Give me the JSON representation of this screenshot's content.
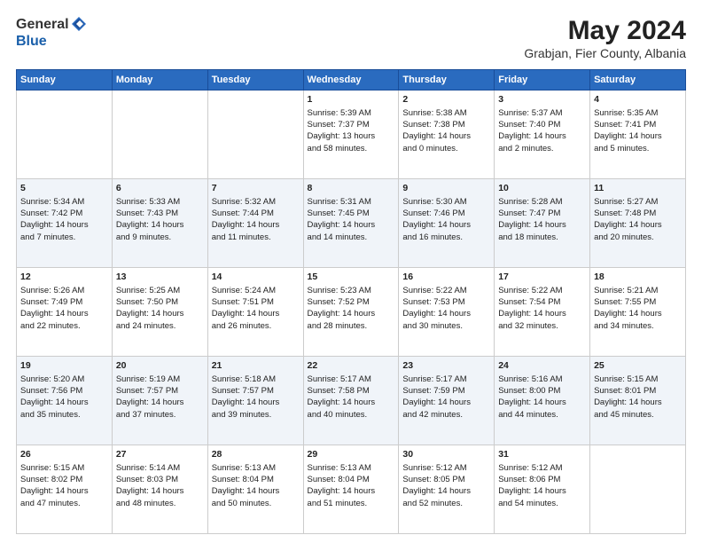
{
  "logo": {
    "general": "General",
    "blue": "Blue"
  },
  "title": "May 2024",
  "subtitle": "Grabjan, Fier County, Albania",
  "days_of_week": [
    "Sunday",
    "Monday",
    "Tuesday",
    "Wednesday",
    "Thursday",
    "Friday",
    "Saturday"
  ],
  "weeks": [
    [
      {
        "day": "",
        "info": ""
      },
      {
        "day": "",
        "info": ""
      },
      {
        "day": "",
        "info": ""
      },
      {
        "day": "1",
        "info": "Sunrise: 5:39 AM\nSunset: 7:37 PM\nDaylight: 13 hours\nand 58 minutes."
      },
      {
        "day": "2",
        "info": "Sunrise: 5:38 AM\nSunset: 7:38 PM\nDaylight: 14 hours\nand 0 minutes."
      },
      {
        "day": "3",
        "info": "Sunrise: 5:37 AM\nSunset: 7:40 PM\nDaylight: 14 hours\nand 2 minutes."
      },
      {
        "day": "4",
        "info": "Sunrise: 5:35 AM\nSunset: 7:41 PM\nDaylight: 14 hours\nand 5 minutes."
      }
    ],
    [
      {
        "day": "5",
        "info": "Sunrise: 5:34 AM\nSunset: 7:42 PM\nDaylight: 14 hours\nand 7 minutes."
      },
      {
        "day": "6",
        "info": "Sunrise: 5:33 AM\nSunset: 7:43 PM\nDaylight: 14 hours\nand 9 minutes."
      },
      {
        "day": "7",
        "info": "Sunrise: 5:32 AM\nSunset: 7:44 PM\nDaylight: 14 hours\nand 11 minutes."
      },
      {
        "day": "8",
        "info": "Sunrise: 5:31 AM\nSunset: 7:45 PM\nDaylight: 14 hours\nand 14 minutes."
      },
      {
        "day": "9",
        "info": "Sunrise: 5:30 AM\nSunset: 7:46 PM\nDaylight: 14 hours\nand 16 minutes."
      },
      {
        "day": "10",
        "info": "Sunrise: 5:28 AM\nSunset: 7:47 PM\nDaylight: 14 hours\nand 18 minutes."
      },
      {
        "day": "11",
        "info": "Sunrise: 5:27 AM\nSunset: 7:48 PM\nDaylight: 14 hours\nand 20 minutes."
      }
    ],
    [
      {
        "day": "12",
        "info": "Sunrise: 5:26 AM\nSunset: 7:49 PM\nDaylight: 14 hours\nand 22 minutes."
      },
      {
        "day": "13",
        "info": "Sunrise: 5:25 AM\nSunset: 7:50 PM\nDaylight: 14 hours\nand 24 minutes."
      },
      {
        "day": "14",
        "info": "Sunrise: 5:24 AM\nSunset: 7:51 PM\nDaylight: 14 hours\nand 26 minutes."
      },
      {
        "day": "15",
        "info": "Sunrise: 5:23 AM\nSunset: 7:52 PM\nDaylight: 14 hours\nand 28 minutes."
      },
      {
        "day": "16",
        "info": "Sunrise: 5:22 AM\nSunset: 7:53 PM\nDaylight: 14 hours\nand 30 minutes."
      },
      {
        "day": "17",
        "info": "Sunrise: 5:22 AM\nSunset: 7:54 PM\nDaylight: 14 hours\nand 32 minutes."
      },
      {
        "day": "18",
        "info": "Sunrise: 5:21 AM\nSunset: 7:55 PM\nDaylight: 14 hours\nand 34 minutes."
      }
    ],
    [
      {
        "day": "19",
        "info": "Sunrise: 5:20 AM\nSunset: 7:56 PM\nDaylight: 14 hours\nand 35 minutes."
      },
      {
        "day": "20",
        "info": "Sunrise: 5:19 AM\nSunset: 7:57 PM\nDaylight: 14 hours\nand 37 minutes."
      },
      {
        "day": "21",
        "info": "Sunrise: 5:18 AM\nSunset: 7:57 PM\nDaylight: 14 hours\nand 39 minutes."
      },
      {
        "day": "22",
        "info": "Sunrise: 5:17 AM\nSunset: 7:58 PM\nDaylight: 14 hours\nand 40 minutes."
      },
      {
        "day": "23",
        "info": "Sunrise: 5:17 AM\nSunset: 7:59 PM\nDaylight: 14 hours\nand 42 minutes."
      },
      {
        "day": "24",
        "info": "Sunrise: 5:16 AM\nSunset: 8:00 PM\nDaylight: 14 hours\nand 44 minutes."
      },
      {
        "day": "25",
        "info": "Sunrise: 5:15 AM\nSunset: 8:01 PM\nDaylight: 14 hours\nand 45 minutes."
      }
    ],
    [
      {
        "day": "26",
        "info": "Sunrise: 5:15 AM\nSunset: 8:02 PM\nDaylight: 14 hours\nand 47 minutes."
      },
      {
        "day": "27",
        "info": "Sunrise: 5:14 AM\nSunset: 8:03 PM\nDaylight: 14 hours\nand 48 minutes."
      },
      {
        "day": "28",
        "info": "Sunrise: 5:13 AM\nSunset: 8:04 PM\nDaylight: 14 hours\nand 50 minutes."
      },
      {
        "day": "29",
        "info": "Sunrise: 5:13 AM\nSunset: 8:04 PM\nDaylight: 14 hours\nand 51 minutes."
      },
      {
        "day": "30",
        "info": "Sunrise: 5:12 AM\nSunset: 8:05 PM\nDaylight: 14 hours\nand 52 minutes."
      },
      {
        "day": "31",
        "info": "Sunrise: 5:12 AM\nSunset: 8:06 PM\nDaylight: 14 hours\nand 54 minutes."
      },
      {
        "day": "",
        "info": ""
      }
    ]
  ]
}
